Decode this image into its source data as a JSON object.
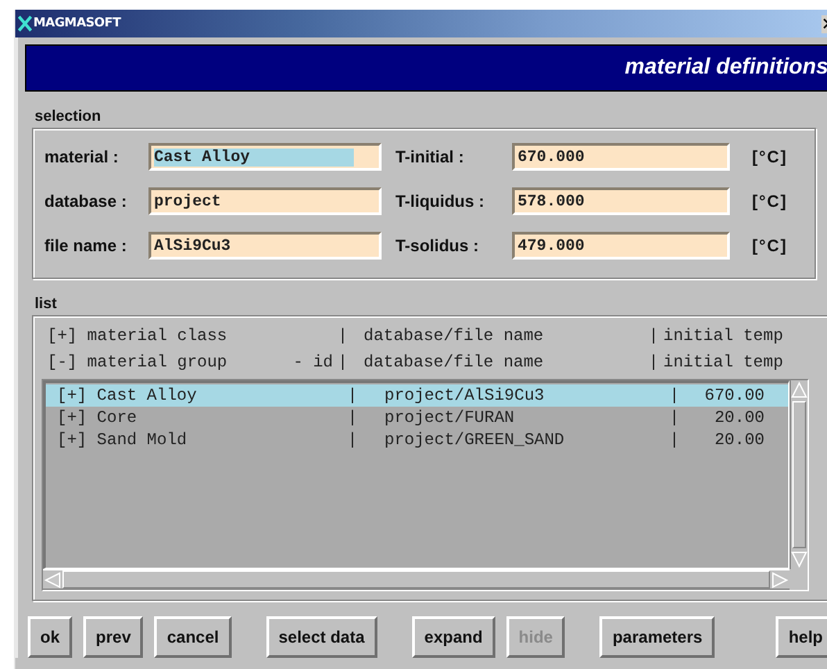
{
  "window": {
    "title": "MAGMASOFT"
  },
  "header": {
    "title": "material definitions"
  },
  "selection": {
    "label": "selection",
    "rows": [
      {
        "label": "material :",
        "value": "Cast Alloy",
        "highlighted": true,
        "t_label": "T-initial :",
        "t_value": "670.000",
        "unit": "[°C]"
      },
      {
        "label": "database :",
        "value": "project",
        "highlighted": false,
        "t_label": "T-liquidus :",
        "t_value": "578.000",
        "unit": "[°C]"
      },
      {
        "label": "file name :",
        "value": "AlSi9Cu3",
        "highlighted": false,
        "t_label": "T-solidus :",
        "t_value": "479.000",
        "unit": "[°C]"
      }
    ]
  },
  "list": {
    "label": "list",
    "headers": [
      {
        "col_1": "[+] material class",
        "sep_1": "|",
        "col_2": "database/file name",
        "sep_2": "|",
        "col_3": "initial temp"
      },
      {
        "col_1": "[-] material group",
        "col_1_suffix": "- id",
        "sep_1": "|",
        "col_2": "database/file name",
        "sep_2": "|",
        "col_3": "initial temp"
      }
    ],
    "rows": [
      {
        "name": "[+] Cast Alloy",
        "sep_1": "|",
        "path": "project/AlSi9Cu3",
        "sep_2": "|",
        "temp": "670.00",
        "selected": true
      },
      {
        "name": "[+] Core",
        "sep_1": "|",
        "path": "project/FURAN",
        "sep_2": "|",
        "temp": "20.00",
        "selected": false
      },
      {
        "name": "[+] Sand Mold",
        "sep_1": "|",
        "path": "project/GREEN_SAND",
        "sep_2": "|",
        "temp": "20.00",
        "selected": false
      }
    ]
  },
  "button_groups": [
    [
      {
        "label": "ok",
        "disabled": false
      },
      {
        "label": "prev",
        "disabled": false
      },
      {
        "label": "cancel",
        "disabled": false
      }
    ],
    [
      {
        "label": "select data",
        "disabled": false
      }
    ],
    [
      {
        "label": "expand",
        "disabled": false
      },
      {
        "label": "hide",
        "disabled": true
      }
    ],
    [
      {
        "label": "parameters",
        "disabled": false
      }
    ],
    [
      {
        "label": "help",
        "disabled": false
      }
    ]
  ]
}
